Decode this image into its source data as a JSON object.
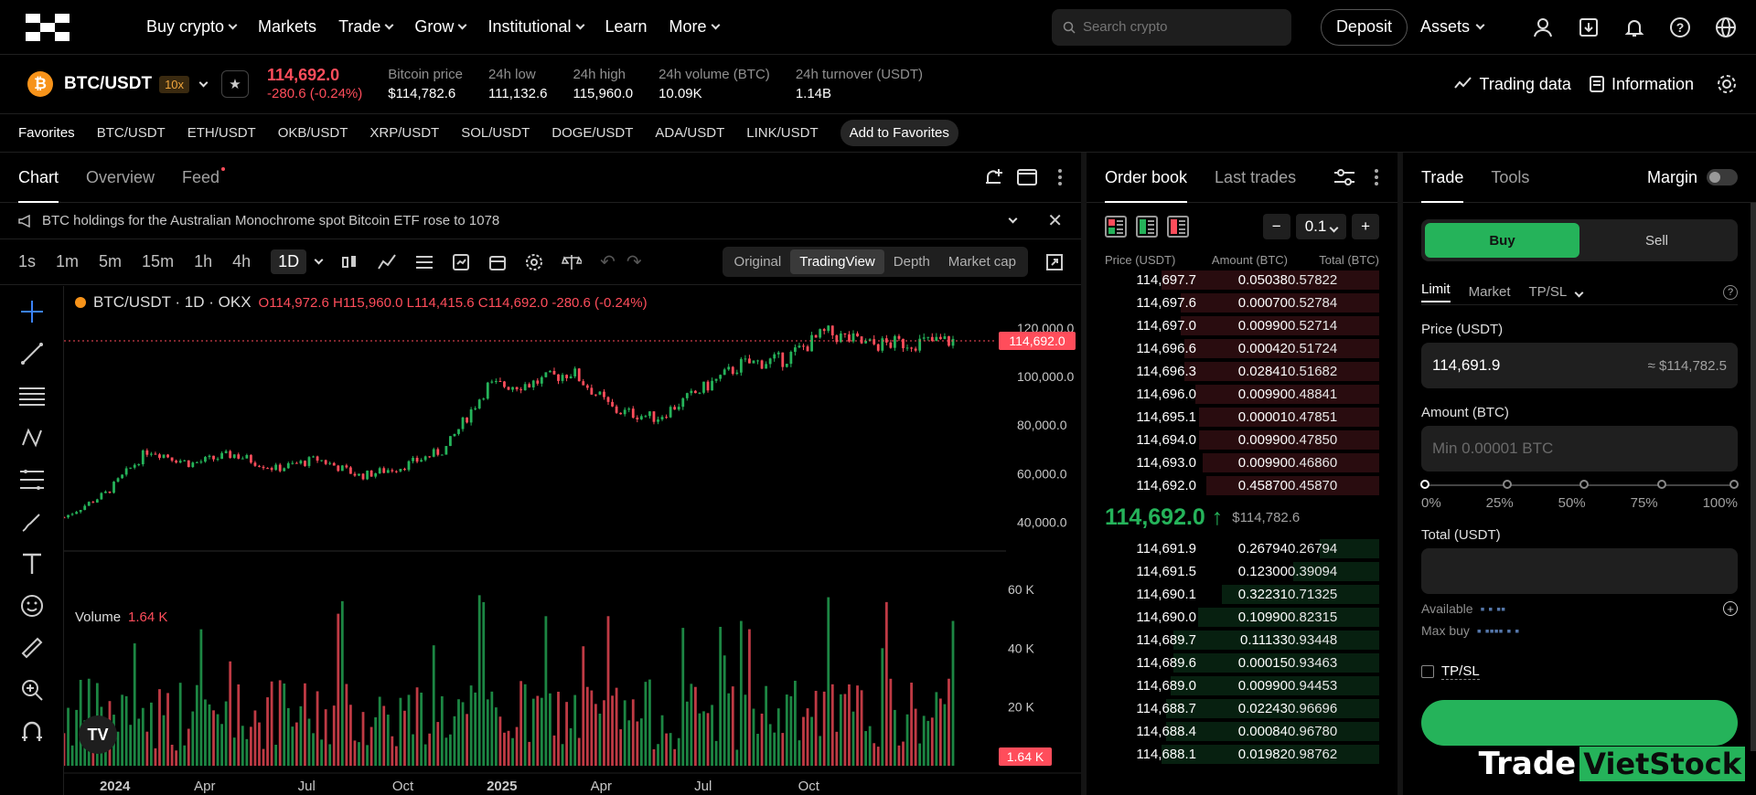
{
  "nav": {
    "items": [
      {
        "label": "Buy crypto",
        "dropdown": true
      },
      {
        "label": "Markets",
        "dropdown": false
      },
      {
        "label": "Trade",
        "dropdown": true
      },
      {
        "label": "Grow",
        "dropdown": true
      },
      {
        "label": "Institutional",
        "dropdown": true
      },
      {
        "label": "Learn",
        "dropdown": false
      },
      {
        "label": "More",
        "dropdown": true
      }
    ],
    "search_placeholder": "Search crypto",
    "deposit": "Deposit",
    "assets": "Assets"
  },
  "ticker": {
    "coin_symbol": "₿",
    "pair": "BTC/USDT",
    "leverage": "10x",
    "price": "114,692.0",
    "change": "-280.6 (-0.24%)",
    "stats": [
      {
        "k": "Bitcoin price",
        "v": "$114,782.6"
      },
      {
        "k": "24h low",
        "v": "111,132.6"
      },
      {
        "k": "24h high",
        "v": "115,960.0"
      },
      {
        "k": "24h volume (BTC)",
        "v": "10.09K"
      },
      {
        "k": "24h turnover (USDT)",
        "v": "1.14B"
      }
    ],
    "trading_data": "Trading data",
    "information": "Information"
  },
  "favorites": {
    "label": "Favorites",
    "pairs": [
      "BTC/USDT",
      "ETH/USDT",
      "OKB/USDT",
      "XRP/USDT",
      "SOL/USDT",
      "DOGE/USDT",
      "ADA/USDT",
      "LINK/USDT"
    ],
    "add": "Add to Favorites"
  },
  "chart_panel": {
    "tabs": [
      "Chart",
      "Overview",
      "Feed"
    ],
    "announcement": "BTC holdings for the Australian Monochrome spot Bitcoin ETF rose to 1078",
    "timeframes": [
      "1s",
      "1m",
      "5m",
      "15m",
      "1h",
      "4h",
      "1D"
    ],
    "active_timeframe": "1D",
    "views": [
      "Original",
      "TradingView",
      "Depth",
      "Market cap"
    ],
    "active_view": "TradingView",
    "legend_title": "BTC/USDT · 1D · OKX",
    "ohlc": "O114,972.6  H115,960.0  L114,415.6  C114,692.0  -280.6 (-0.24%)",
    "volume_label": "Volume",
    "volume_value": "1.64 K"
  },
  "chart_data": {
    "type": "candlestick",
    "price_axis": [
      "120,000.0",
      "100,000.0",
      "80,000.0",
      "60,000.0",
      "40,000.0"
    ],
    "price_ticks": [
      120000,
      100000,
      80000,
      60000,
      40000
    ],
    "volume_axis": [
      "60 K",
      "40 K",
      "20 K"
    ],
    "volume_ticks": [
      60,
      40,
      20
    ],
    "time_axis": [
      "2024",
      "Apr",
      "Jul",
      "Oct",
      "2025",
      "Apr",
      "Jul",
      "Oct"
    ],
    "last_price_label": "114,692.0",
    "last_volume_label": "1.64 K",
    "ylim": [
      30000,
      126000
    ],
    "trend": [
      {
        "d": "2024-01",
        "v": 42000
      },
      {
        "d": "2024-02",
        "v": 52000
      },
      {
        "d": "2024-03",
        "v": 70000
      },
      {
        "d": "2024-04",
        "v": 64000
      },
      {
        "d": "2024-05",
        "v": 68000
      },
      {
        "d": "2024-06",
        "v": 62000
      },
      {
        "d": "2024-07",
        "v": 66000
      },
      {
        "d": "2024-08",
        "v": 59000
      },
      {
        "d": "2024-09",
        "v": 63000
      },
      {
        "d": "2024-10",
        "v": 70000
      },
      {
        "d": "2024-11",
        "v": 96000
      },
      {
        "d": "2024-12",
        "v": 97000
      },
      {
        "d": "2025-01",
        "v": 102000
      },
      {
        "d": "2025-02",
        "v": 86000
      },
      {
        "d": "2025-03",
        "v": 83000
      },
      {
        "d": "2025-04",
        "v": 94000
      },
      {
        "d": "2025-05",
        "v": 105000
      },
      {
        "d": "2025-06",
        "v": 107000
      },
      {
        "d": "2025-07",
        "v": 118000
      },
      {
        "d": "2025-08",
        "v": 113000
      },
      {
        "d": "2025-09",
        "v": 114000
      },
      {
        "d": "2025-10",
        "v": 114692
      }
    ]
  },
  "orderbook": {
    "tabs": [
      "Order book",
      "Last trades"
    ],
    "step": "0.1",
    "headers": [
      "Price (USDT)",
      "Amount (BTC)",
      "Total (BTC)"
    ],
    "asks": [
      [
        "114,697.7",
        "0.05038",
        "0.57822"
      ],
      [
        "114,697.6",
        "0.00070",
        "0.52784"
      ],
      [
        "114,697.0",
        "0.00990",
        "0.52714"
      ],
      [
        "114,696.6",
        "0.00042",
        "0.51724"
      ],
      [
        "114,696.3",
        "0.02841",
        "0.51682"
      ],
      [
        "114,696.0",
        "0.00990",
        "0.48841"
      ],
      [
        "114,695.1",
        "0.00001",
        "0.47851"
      ],
      [
        "114,694.0",
        "0.00990",
        "0.47850"
      ],
      [
        "114,693.0",
        "0.00990",
        "0.46860"
      ],
      [
        "114,692.0",
        "0.45870",
        "0.45870"
      ]
    ],
    "mid_price": "114,692.0 ↑",
    "mid_usd": "$114,782.6",
    "bids": [
      [
        "114,691.9",
        "0.26794",
        "0.26794"
      ],
      [
        "114,691.5",
        "0.12300",
        "0.39094"
      ],
      [
        "114,690.1",
        "0.32231",
        "0.71325"
      ],
      [
        "114,690.0",
        "0.10990",
        "0.82315"
      ],
      [
        "114,689.7",
        "0.11133",
        "0.93448"
      ],
      [
        "114,689.6",
        "0.00015",
        "0.93463"
      ],
      [
        "114,689.0",
        "0.00990",
        "0.94453"
      ],
      [
        "114,688.7",
        "0.02243",
        "0.96696"
      ],
      [
        "114,688.4",
        "0.00084",
        "0.96780"
      ],
      [
        "114,688.1",
        "0.01982",
        "0.98762"
      ]
    ]
  },
  "trade": {
    "tabs": [
      "Trade",
      "Tools"
    ],
    "margin": "Margin",
    "buy": "Buy",
    "sell": "Sell",
    "order_types": [
      "Limit",
      "Market",
      "TP/SL"
    ],
    "price_label": "Price (USDT)",
    "price_value": "114,691.9",
    "price_approx": "≈ $114,782.5",
    "amount_label": "Amount (BTC)",
    "amount_placeholder": "Min 0.00001 BTC",
    "slider_labels": [
      "0%",
      "25%",
      "50%",
      "75%",
      "100%"
    ],
    "total_label": "Total (USDT)",
    "available": "Available",
    "max_buy": "Max buy",
    "tpsl": "TP/SL"
  },
  "watermark": {
    "a": "Trade",
    "b": "VietStock"
  },
  "colors": {
    "up": "#25b35a",
    "down": "#ff4d5b",
    "bg": "#000000"
  }
}
